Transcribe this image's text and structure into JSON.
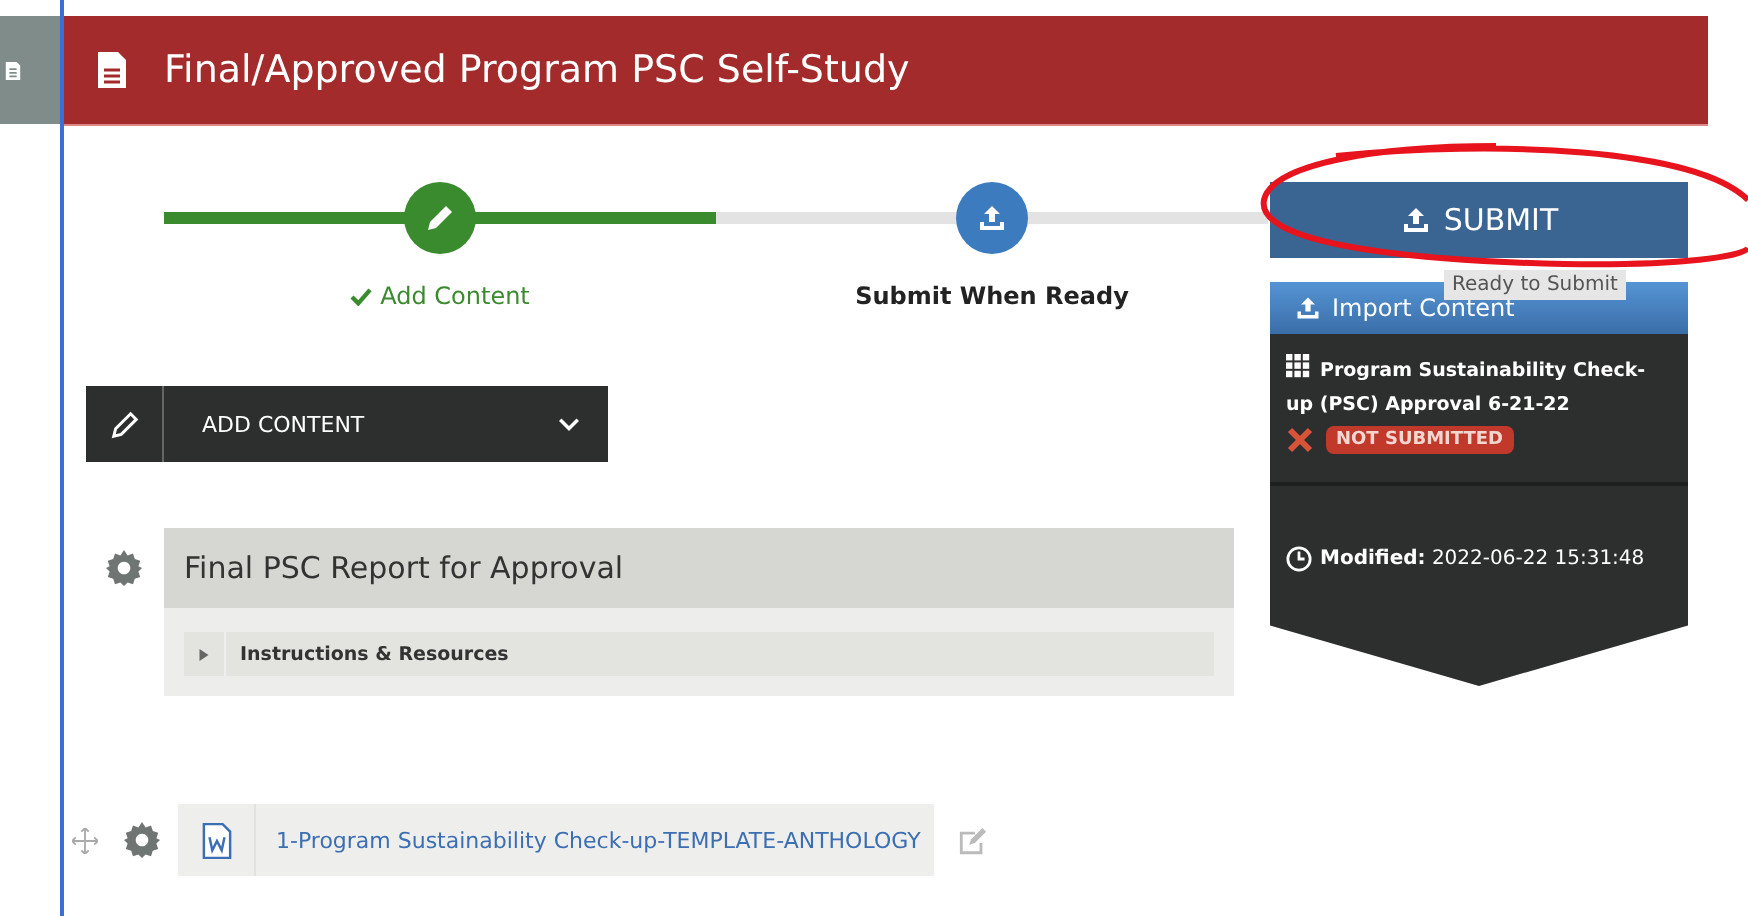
{
  "header": {
    "title": "Final/Approved Program PSC Self-Study"
  },
  "steps": [
    {
      "label": "Add Content",
      "kind": "edit",
      "completed": true
    },
    {
      "label": "Submit When Ready",
      "kind": "upload",
      "completed": false
    }
  ],
  "submit_button": {
    "label": "SUBMIT",
    "tooltip": "Ready to Submit"
  },
  "add_content_menu": {
    "label": "ADD CONTENT"
  },
  "sections": [
    {
      "title": "Final PSC Report for Approval",
      "subsections": [
        {
          "label": "Instructions & Resources",
          "expanded": false
        }
      ]
    }
  ],
  "files": [
    {
      "name": "1-Program Sustainability Check-up-TEMPLATE-ANTHOLOGY",
      "kind": "word"
    }
  ],
  "import_panel": {
    "title": "Import Content",
    "item": {
      "name": "Program Sustainability Check-up (PSC) Approval 6-21-22",
      "status": "NOT SUBMITTED",
      "submitted": false
    },
    "modified": "**Modified:** 2022-06-22 15:31:48"
  }
}
